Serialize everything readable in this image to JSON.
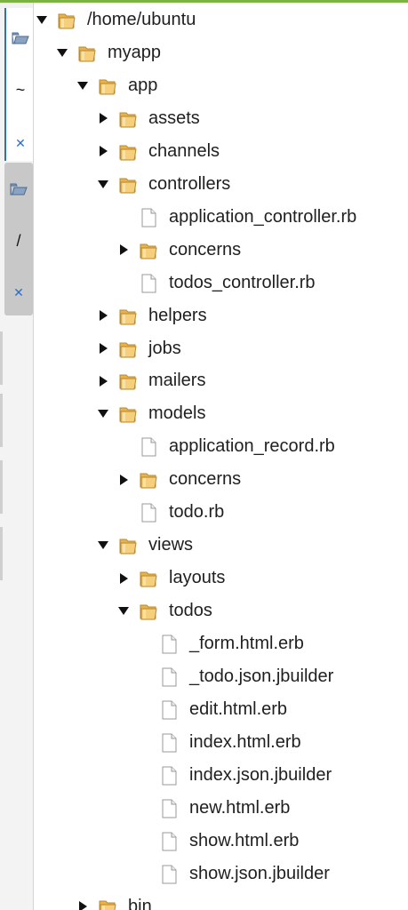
{
  "dock": {
    "tabs": [
      {
        "icon": "folder-icon",
        "label": "~",
        "close": "✕"
      },
      {
        "icon": "folder-icon",
        "label": "/",
        "close": "✕"
      }
    ]
  },
  "tree": [
    {
      "label": "/home/ubuntu",
      "type": "folder",
      "expanded": true,
      "depth": 0
    },
    {
      "label": "myapp",
      "type": "folder",
      "expanded": true,
      "depth": 1
    },
    {
      "label": "app",
      "type": "folder",
      "expanded": true,
      "depth": 2
    },
    {
      "label": "assets",
      "type": "folder",
      "expanded": false,
      "depth": 3
    },
    {
      "label": "channels",
      "type": "folder",
      "expanded": false,
      "depth": 3
    },
    {
      "label": "controllers",
      "type": "folder",
      "expanded": true,
      "depth": 3
    },
    {
      "label": "application_controller.rb",
      "type": "file",
      "depth": 4
    },
    {
      "label": "concerns",
      "type": "folder",
      "expanded": false,
      "depth": 4
    },
    {
      "label": "todos_controller.rb",
      "type": "file",
      "depth": 4
    },
    {
      "label": "helpers",
      "type": "folder",
      "expanded": false,
      "depth": 3
    },
    {
      "label": "jobs",
      "type": "folder",
      "expanded": false,
      "depth": 3
    },
    {
      "label": "mailers",
      "type": "folder",
      "expanded": false,
      "depth": 3
    },
    {
      "label": "models",
      "type": "folder",
      "expanded": true,
      "depth": 3
    },
    {
      "label": "application_record.rb",
      "type": "file",
      "depth": 4
    },
    {
      "label": "concerns",
      "type": "folder",
      "expanded": false,
      "depth": 4
    },
    {
      "label": "todo.rb",
      "type": "file",
      "depth": 4
    },
    {
      "label": "views",
      "type": "folder",
      "expanded": true,
      "depth": 3
    },
    {
      "label": "layouts",
      "type": "folder",
      "expanded": false,
      "depth": 4
    },
    {
      "label": "todos",
      "type": "folder",
      "expanded": true,
      "depth": 4
    },
    {
      "label": "_form.html.erb",
      "type": "file",
      "depth": 5
    },
    {
      "label": "_todo.json.jbuilder",
      "type": "file",
      "depth": 5
    },
    {
      "label": "edit.html.erb",
      "type": "file",
      "depth": 5
    },
    {
      "label": "index.html.erb",
      "type": "file",
      "depth": 5
    },
    {
      "label": "index.json.jbuilder",
      "type": "file",
      "depth": 5
    },
    {
      "label": "new.html.erb",
      "type": "file",
      "depth": 5
    },
    {
      "label": "show.html.erb",
      "type": "file",
      "depth": 5
    },
    {
      "label": "show.json.jbuilder",
      "type": "file",
      "depth": 5
    },
    {
      "label": "bin",
      "type": "folder",
      "expanded": false,
      "depth": 2
    }
  ],
  "colors": {
    "accent": "#7cb342",
    "tab_active_border": "#2a6fc9",
    "folder_fill": "#f2c46a",
    "folder_stroke": "#b98a2e",
    "close_x": "#2a6fc9"
  }
}
